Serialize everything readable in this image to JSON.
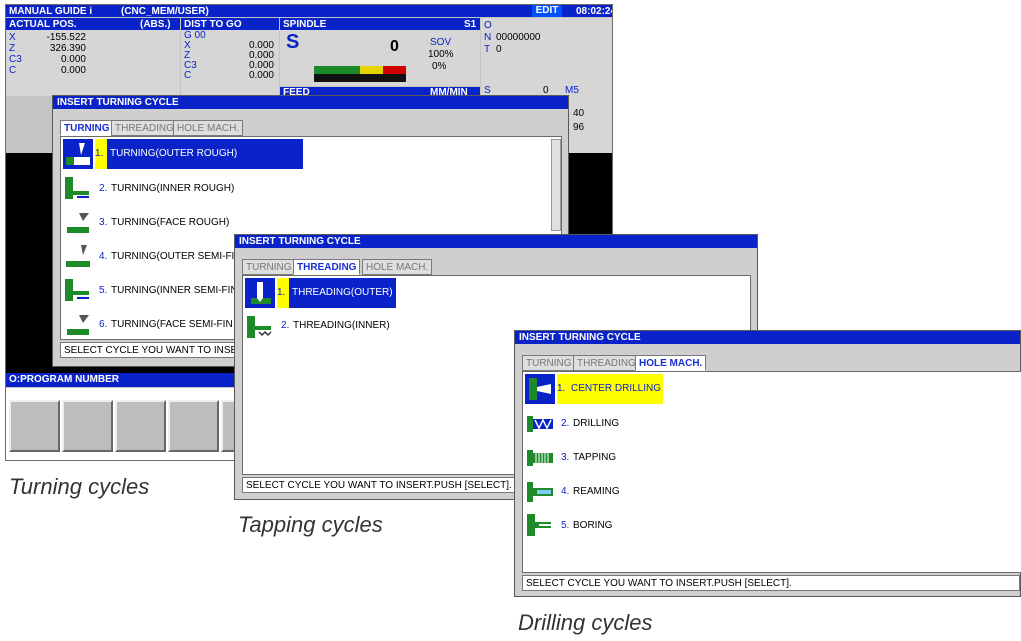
{
  "screen": {
    "mode": "MANUAL GUIDE i",
    "program_path": "(CNC_MEM/USER)",
    "edit_badge": "EDIT",
    "clock": "08:02:24",
    "actual_pos": {
      "title": "ACTUAL POS.",
      "mode": "(ABS.)",
      "axes": [
        {
          "axis": "X",
          "value": "-155.522"
        },
        {
          "axis": "Z",
          "value": "326.390"
        },
        {
          "axis": "C3",
          "value": "0.000"
        },
        {
          "axis": "C",
          "value": "0.000"
        }
      ]
    },
    "dist_to_go": {
      "title": "DIST TO GO",
      "gcode": "G 00",
      "axes": [
        {
          "axis": "X",
          "value": "0.000"
        },
        {
          "axis": "Z",
          "value": "0.000"
        },
        {
          "axis": "C3",
          "value": "0.000"
        },
        {
          "axis": "C",
          "value": "0.000"
        }
      ]
    },
    "spindle": {
      "title": "SPINDLE",
      "id": "S1",
      "s_letter": "S",
      "value": "0",
      "sov_label": "SOV",
      "sov_value": "100%",
      "load": "0%"
    },
    "feed_title": "FEED",
    "feed_unit": "MM/MIN",
    "right_panel": {
      "o_label": "O",
      "n_label": "N",
      "n_value": "00000000",
      "t_label": "T",
      "t_value": "0",
      "s_label": "S",
      "s_value": "0",
      "m_code": "M5",
      "v1": "40",
      "v2": "96"
    },
    "program_number": "O:PROGRAM NUMBER"
  },
  "dialog_turning": {
    "title": "INSERT TURNING CYCLE",
    "tabs": [
      "TURNING",
      "THREADING",
      "HOLE MACH."
    ],
    "items": [
      {
        "num": "1.",
        "label": "TURNING(OUTER ROUGH)"
      },
      {
        "num": "2.",
        "label": "TURNING(INNER ROUGH)"
      },
      {
        "num": "3.",
        "label": "TURNING(FACE ROUGH)"
      },
      {
        "num": "4.",
        "label": "TURNING(OUTER SEMI-FI"
      },
      {
        "num": "5.",
        "label": "TURNING(INNER SEMI-FIN"
      },
      {
        "num": "6.",
        "label": "TURNING(FACE SEMI-FIN"
      }
    ],
    "status": "SELECT CYCLE YOU WANT TO INSE"
  },
  "dialog_threading": {
    "title": "INSERT TURNING CYCLE",
    "tabs": [
      "TURNING",
      "THREADING",
      "HOLE MACH."
    ],
    "items": [
      {
        "num": "1.",
        "label": "THREADING(OUTER)"
      },
      {
        "num": "2.",
        "label": "THREADING(INNER)"
      }
    ],
    "status": "SELECT CYCLE YOU WANT TO INSERT.PUSH [SELECT]."
  },
  "dialog_hole": {
    "title": "INSERT TURNING CYCLE",
    "tabs": [
      "TURNING",
      "THREADING",
      "HOLE MACH."
    ],
    "items": [
      {
        "num": "1.",
        "label": "CENTER DRILLING"
      },
      {
        "num": "2.",
        "label": "DRILLING"
      },
      {
        "num": "3.",
        "label": "TAPPING"
      },
      {
        "num": "4.",
        "label": "REAMING"
      },
      {
        "num": "5.",
        "label": "BORING"
      }
    ],
    "status": "SELECT CYCLE YOU WANT TO INSERT.PUSH [SELECT]."
  },
  "captions": {
    "turning": "Turning cycles",
    "tapping": "Tapping cycles",
    "drilling": "Drilling cycles"
  },
  "colors": {
    "title_bar": "#0a23c8",
    "highlight": "#ffff00",
    "icon_green": "#1f8a2a"
  }
}
